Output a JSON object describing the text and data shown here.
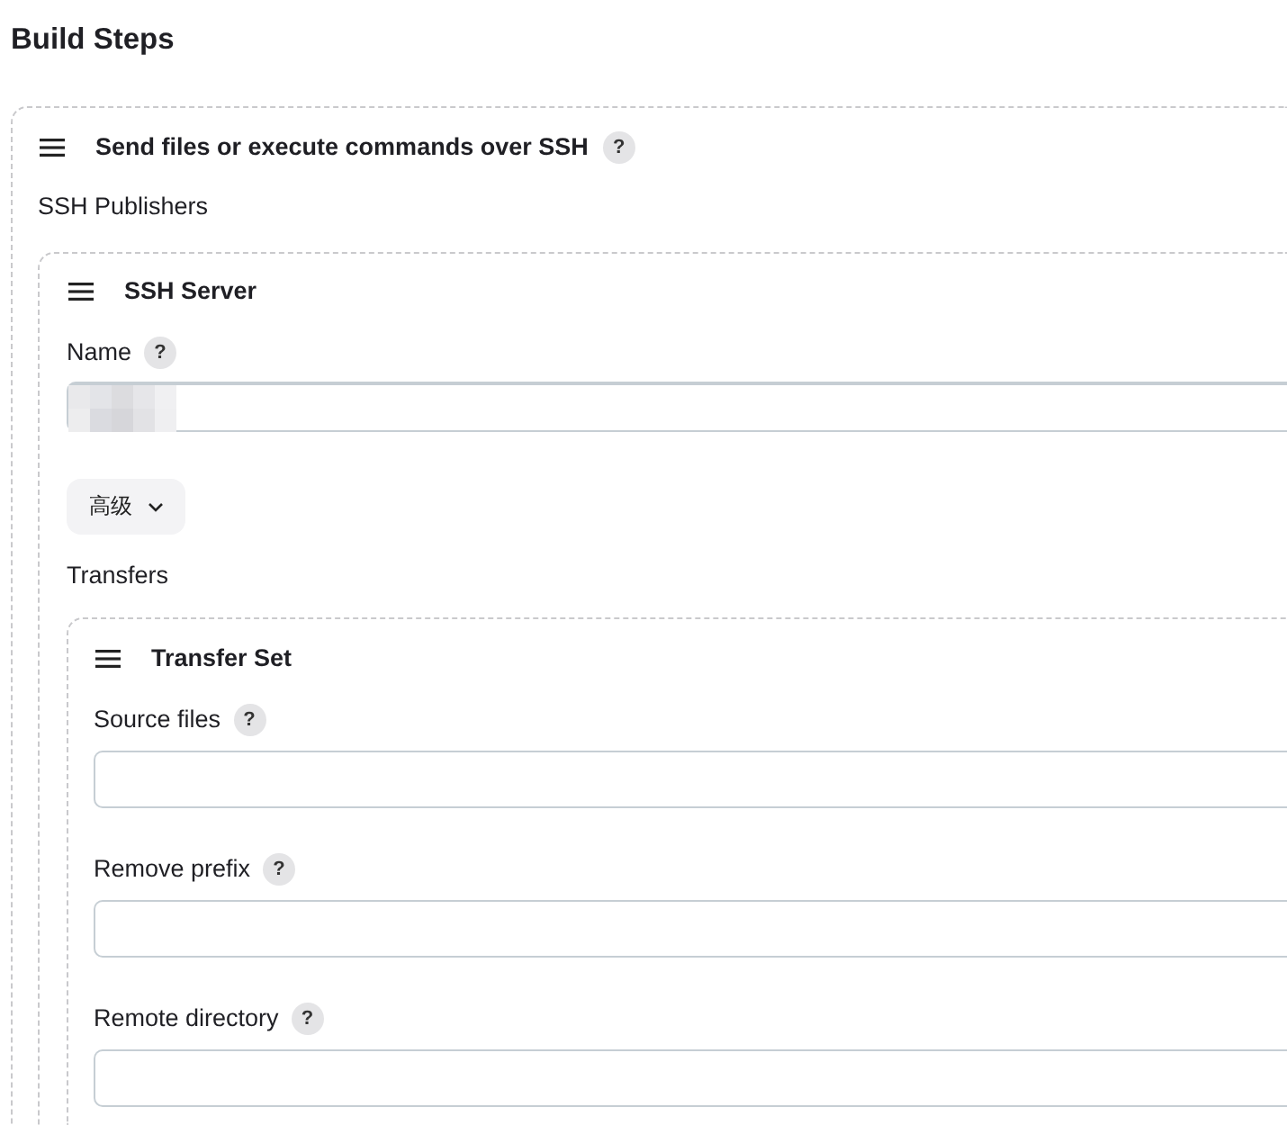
{
  "heading": "Build Steps",
  "step": {
    "title": "Send files or execute commands over SSH",
    "help": "?",
    "section_label": "SSH Publishers",
    "server": {
      "title": "SSH Server",
      "name_field": {
        "label": "Name",
        "help": "?",
        "value_obscured": true
      },
      "advanced_button": "高级",
      "section_label": "Transfers",
      "transfer_set": {
        "title": "Transfer Set",
        "fields": [
          {
            "label": "Source files",
            "help": "?"
          },
          {
            "label": "Remove prefix",
            "help": "?"
          },
          {
            "label": "Remote directory",
            "help": "?"
          }
        ]
      }
    }
  }
}
